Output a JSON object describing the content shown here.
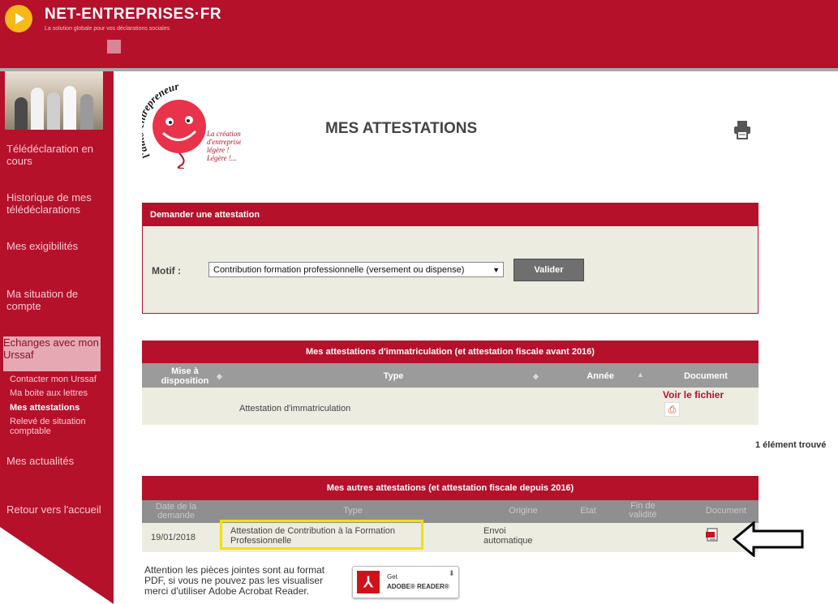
{
  "header": {
    "brand": "NET-ENTREPRISES·FR",
    "tagline": "La solution globale pour vos déclarations sociales"
  },
  "sidebar": {
    "items": [
      {
        "label": "Télédéclaration en cours"
      },
      {
        "label": "Historique de mes télédéclarations"
      },
      {
        "label": "Mes exigibilités"
      },
      {
        "label": "Ma situation de compte"
      },
      {
        "label": "Echanges avec mon Urssaf"
      },
      {
        "label": "Mes actualités"
      },
      {
        "label": "Retour vers l'accueil"
      }
    ],
    "subitems": [
      {
        "label": "Contacter mon Urssaf"
      },
      {
        "label": "Ma boite aux lettres"
      },
      {
        "label": "Mes attestations"
      },
      {
        "label": "Relevé de situation comptable"
      }
    ]
  },
  "logo": {
    "arc": "l'auto-entrepreneur",
    "slogan": "La création d'entreprise légère ! Légère !..."
  },
  "page": {
    "title": "MES ATTESTATIONS"
  },
  "request": {
    "header": "Demander une attestation",
    "motif_label": "Motif :",
    "motif_value": "Contribution formation professionnelle (versement ou dispense)",
    "button": "Valider"
  },
  "table1": {
    "title": "Mes attestations d'immatriculation (et attestation fiscale avant 2016)",
    "columns": [
      "Mise à disposition",
      "Type",
      "Année",
      "Document"
    ],
    "rows": [
      {
        "mise": "",
        "type": "Attestation d'immatriculation",
        "annee": "",
        "doc_link": "Voir le fichier"
      }
    ],
    "count": "1 élément trouvé"
  },
  "table2": {
    "title": "Mes autres attestations (et attestation fiscale depuis 2016)",
    "columns": [
      "Date de la demande",
      "Type",
      "Origine",
      "Etat",
      "Fin de validité",
      "Document"
    ],
    "rows": [
      {
        "date": "19/01/2018",
        "type": "Attestation de Contribution à la Formation Professionnelle",
        "origine": "Envoi automatique",
        "etat": "",
        "fin": ""
      }
    ]
  },
  "footer": {
    "warning": "Attention les pièces jointes sont au format PDF, si vous ne pouvez pas les visualiser merci d'utiliser Adobe Acrobat Reader.",
    "adobe_get": "Get",
    "adobe_name": "ADOBE® READER®"
  },
  "colors": {
    "brand": "#b5112b",
    "highlight": "#f5e100"
  }
}
